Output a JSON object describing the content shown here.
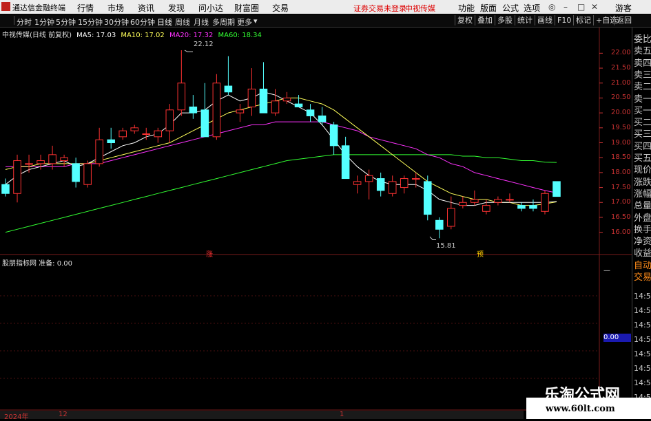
{
  "menu": {
    "app_title": "通达信金融终端",
    "items": [
      "行情",
      "市场",
      "资讯",
      "发现",
      "问小达",
      "财富圈",
      "交易"
    ],
    "login_warning": "证券交易未登录",
    "stock_name_top": "中视传媒",
    "right_items": [
      "功能",
      "版面",
      "公式",
      "选项"
    ],
    "user": "游客"
  },
  "periods": [
    "分时",
    "1分钟",
    "5分钟",
    "15分钟",
    "30分钟",
    "60分钟",
    "日线",
    "周线",
    "月线",
    "多周期",
    "更多"
  ],
  "active_period": "日线",
  "tools": [
    "复权",
    "叠加",
    "多股",
    "统计",
    "画线",
    "F10",
    "标记",
    "+自选",
    "返回"
  ],
  "legend": {
    "title": "中视传媒(日线 前复权)",
    "ma5": "MA5: 17.03",
    "ma10": "MA10: 17.02",
    "ma20": "MA20: 17.32",
    "ma60": "MA60: 18.34"
  },
  "colors": {
    "up": "#ff3232",
    "down": "#54ffff",
    "ma5": "#ffffff",
    "ma10": "#ffff5a",
    "ma20": "#ff32ff",
    "ma60": "#32ff32"
  },
  "y_axis": [
    "22.00",
    "21.50",
    "21.00",
    "20.50",
    "20.00",
    "19.50",
    "19.00",
    "18.50",
    "18.00",
    "17.50",
    "17.00",
    "16.50",
    "16.00"
  ],
  "annotations": {
    "high": "22.12",
    "low": "15.81",
    "rise_marker": "涨",
    "predict_marker": "预"
  },
  "sub_legend": "股朋指标网 准备: 0.00",
  "sub_value": "0.00",
  "right_panel": {
    "labels": [
      "委比",
      "卖五",
      "卖四",
      "卖三",
      "卖二",
      "卖一",
      "买一",
      "买二",
      "买三",
      "买四",
      "买五",
      "现价",
      "涨跌",
      "涨幅",
      "总量",
      "外盘",
      "换手",
      "净资",
      "收益",
      "自动",
      "交易"
    ],
    "times": [
      "14:56",
      "14:56",
      "14:56",
      "14:56",
      "14:56",
      "14:56",
      "14:56",
      "14:56"
    ]
  },
  "bottom": {
    "year": "2024年",
    "dec": "12",
    "jan": "1"
  },
  "watermark": {
    "title": "乐淘公式网",
    "url": "www.60lt.com"
  },
  "chart_data": {
    "type": "candlestick",
    "y_range": [
      15.6,
      22.4
    ],
    "candles": [
      {
        "o": 17.6,
        "h": 17.8,
        "l": 17.2,
        "c": 17.3
      },
      {
        "o": 17.3,
        "h": 18.6,
        "l": 17.0,
        "c": 18.4
      },
      {
        "o": 18.3,
        "h": 18.6,
        "l": 18.0,
        "c": 18.3
      },
      {
        "o": 18.3,
        "h": 18.6,
        "l": 18.1,
        "c": 18.4
      },
      {
        "o": 18.3,
        "h": 18.9,
        "l": 18.1,
        "c": 18.6
      },
      {
        "o": 18.4,
        "h": 18.6,
        "l": 18.2,
        "c": 18.5
      },
      {
        "o": 18.3,
        "h": 18.5,
        "l": 17.5,
        "c": 17.7
      },
      {
        "o": 17.6,
        "h": 18.4,
        "l": 17.5,
        "c": 18.3
      },
      {
        "o": 18.3,
        "h": 19.5,
        "l": 18.2,
        "c": 19.1
      },
      {
        "o": 19.1,
        "h": 19.5,
        "l": 18.8,
        "c": 19.0
      },
      {
        "o": 19.2,
        "h": 19.5,
        "l": 19.1,
        "c": 19.4
      },
      {
        "o": 19.4,
        "h": 19.6,
        "l": 19.3,
        "c": 19.5
      },
      {
        "o": 19.3,
        "h": 19.5,
        "l": 19.1,
        "c": 19.3
      },
      {
        "o": 19.2,
        "h": 19.5,
        "l": 19.0,
        "c": 19.4
      },
      {
        "o": 19.4,
        "h": 20.3,
        "l": 19.0,
        "c": 20.1
      },
      {
        "o": 20.1,
        "h": 22.1,
        "l": 19.9,
        "c": 21.0
      },
      {
        "o": 20.2,
        "h": 20.6,
        "l": 19.8,
        "c": 20.0
      },
      {
        "o": 20.1,
        "h": 21.0,
        "l": 19.4,
        "c": 19.2
      },
      {
        "o": 19.2,
        "h": 21.3,
        "l": 19.1,
        "c": 21.0
      },
      {
        "o": 20.9,
        "h": 21.9,
        "l": 20.6,
        "c": 20.7
      },
      {
        "o": 20.0,
        "h": 20.3,
        "l": 19.7,
        "c": 20.1
      },
      {
        "o": 20.2,
        "h": 21.5,
        "l": 19.9,
        "c": 20.8
      },
      {
        "o": 20.8,
        "h": 21.7,
        "l": 20.2,
        "c": 20.0
      },
      {
        "o": 20.0,
        "h": 20.8,
        "l": 19.9,
        "c": 20.4
      },
      {
        "o": 20.4,
        "h": 20.7,
        "l": 20.3,
        "c": 20.5
      },
      {
        "o": 20.3,
        "h": 20.6,
        "l": 20.2,
        "c": 20.2
      },
      {
        "o": 20.1,
        "h": 20.3,
        "l": 19.7,
        "c": 19.9
      },
      {
        "o": 19.9,
        "h": 20.2,
        "l": 19.6,
        "c": 19.7
      },
      {
        "o": 19.6,
        "h": 19.7,
        "l": 18.6,
        "c": 18.9
      },
      {
        "o": 18.9,
        "h": 19.2,
        "l": 17.8,
        "c": 17.8
      },
      {
        "o": 17.6,
        "h": 17.9,
        "l": 17.3,
        "c": 17.7
      },
      {
        "o": 17.7,
        "h": 18.1,
        "l": 17.1,
        "c": 17.9
      },
      {
        "o": 17.8,
        "h": 18.0,
        "l": 17.2,
        "c": 17.4
      },
      {
        "o": 17.3,
        "h": 17.9,
        "l": 17.2,
        "c": 17.7
      },
      {
        "o": 17.5,
        "h": 17.9,
        "l": 17.3,
        "c": 17.8
      },
      {
        "o": 17.8,
        "h": 18.0,
        "l": 17.5,
        "c": 17.8
      },
      {
        "o": 17.7,
        "h": 17.9,
        "l": 16.4,
        "c": 16.6
      },
      {
        "o": 16.4,
        "h": 16.5,
        "l": 15.8,
        "c": 16.1
      },
      {
        "o": 16.2,
        "h": 17.2,
        "l": 16.1,
        "c": 16.8
      },
      {
        "o": 16.9,
        "h": 17.2,
        "l": 16.8,
        "c": 17.0
      },
      {
        "o": 17.0,
        "h": 17.4,
        "l": 16.9,
        "c": 17.1
      },
      {
        "o": 16.7,
        "h": 17.1,
        "l": 16.6,
        "c": 16.9
      },
      {
        "o": 17.0,
        "h": 17.2,
        "l": 16.9,
        "c": 17.1
      },
      {
        "o": 17.1,
        "h": 17.3,
        "l": 17.0,
        "c": 17.1
      },
      {
        "o": 16.9,
        "h": 17.0,
        "l": 16.7,
        "c": 16.8
      },
      {
        "o": 16.9,
        "h": 17.1,
        "l": 16.7,
        "c": 16.8
      },
      {
        "o": 16.7,
        "h": 17.4,
        "l": 16.6,
        "c": 17.3
      },
      {
        "o": 17.7,
        "h": 17.7,
        "l": 17.2,
        "c": 17.2
      }
    ],
    "ma5": [
      17.6,
      17.9,
      18.1,
      18.2,
      18.3,
      18.4,
      18.2,
      18.3,
      18.5,
      18.7,
      18.9,
      19.0,
      19.2,
      19.3,
      19.6,
      20.0,
      20.0,
      20.1,
      20.4,
      20.6,
      20.4,
      20.5,
      20.7,
      20.6,
      20.4,
      20.2,
      20.0,
      19.6,
      19.1,
      18.6,
      18.2,
      17.9,
      17.7,
      17.6,
      17.6,
      17.6,
      17.4,
      17.1,
      17.0,
      16.9,
      16.9,
      17.0,
      17.0,
      17.0,
      17.0,
      17.0,
      17.0,
      17.03
    ],
    "ma10": [
      18.1,
      18.2,
      18.2,
      18.3,
      18.3,
      18.3,
      18.3,
      18.3,
      18.4,
      18.5,
      18.6,
      18.7,
      18.8,
      18.9,
      19.0,
      19.2,
      19.4,
      19.6,
      19.8,
      20.0,
      20.1,
      20.2,
      20.3,
      20.4,
      20.5,
      20.5,
      20.4,
      20.3,
      20.1,
      19.8,
      19.5,
      19.2,
      18.9,
      18.6,
      18.3,
      18.0,
      17.7,
      17.5,
      17.3,
      17.2,
      17.1,
      17.1,
      17.0,
      17.0,
      16.9,
      16.9,
      16.95,
      17.02
    ],
    "ma20": [
      18.2,
      18.2,
      18.2,
      18.2,
      18.2,
      18.2,
      18.3,
      18.3,
      18.3,
      18.4,
      18.5,
      18.6,
      18.7,
      18.8,
      18.9,
      19.0,
      19.1,
      19.2,
      19.3,
      19.4,
      19.5,
      19.6,
      19.6,
      19.7,
      19.7,
      19.7,
      19.7,
      19.7,
      19.6,
      19.5,
      19.4,
      19.2,
      19.1,
      19.0,
      18.9,
      18.8,
      18.6,
      18.5,
      18.3,
      18.2,
      18.0,
      17.9,
      17.8,
      17.7,
      17.6,
      17.5,
      17.4,
      17.32
    ],
    "ma60": [
      16.0,
      16.1,
      16.2,
      16.3,
      16.4,
      16.5,
      16.6,
      16.7,
      16.8,
      16.9,
      17.0,
      17.1,
      17.2,
      17.3,
      17.4,
      17.5,
      17.6,
      17.7,
      17.8,
      17.9,
      18.0,
      18.1,
      18.2,
      18.3,
      18.4,
      18.45,
      18.5,
      18.55,
      18.6,
      18.6,
      18.6,
      18.6,
      18.6,
      18.6,
      18.6,
      18.6,
      18.6,
      18.6,
      18.6,
      18.55,
      18.55,
      18.5,
      18.5,
      18.45,
      18.4,
      18.4,
      18.35,
      18.34
    ]
  }
}
